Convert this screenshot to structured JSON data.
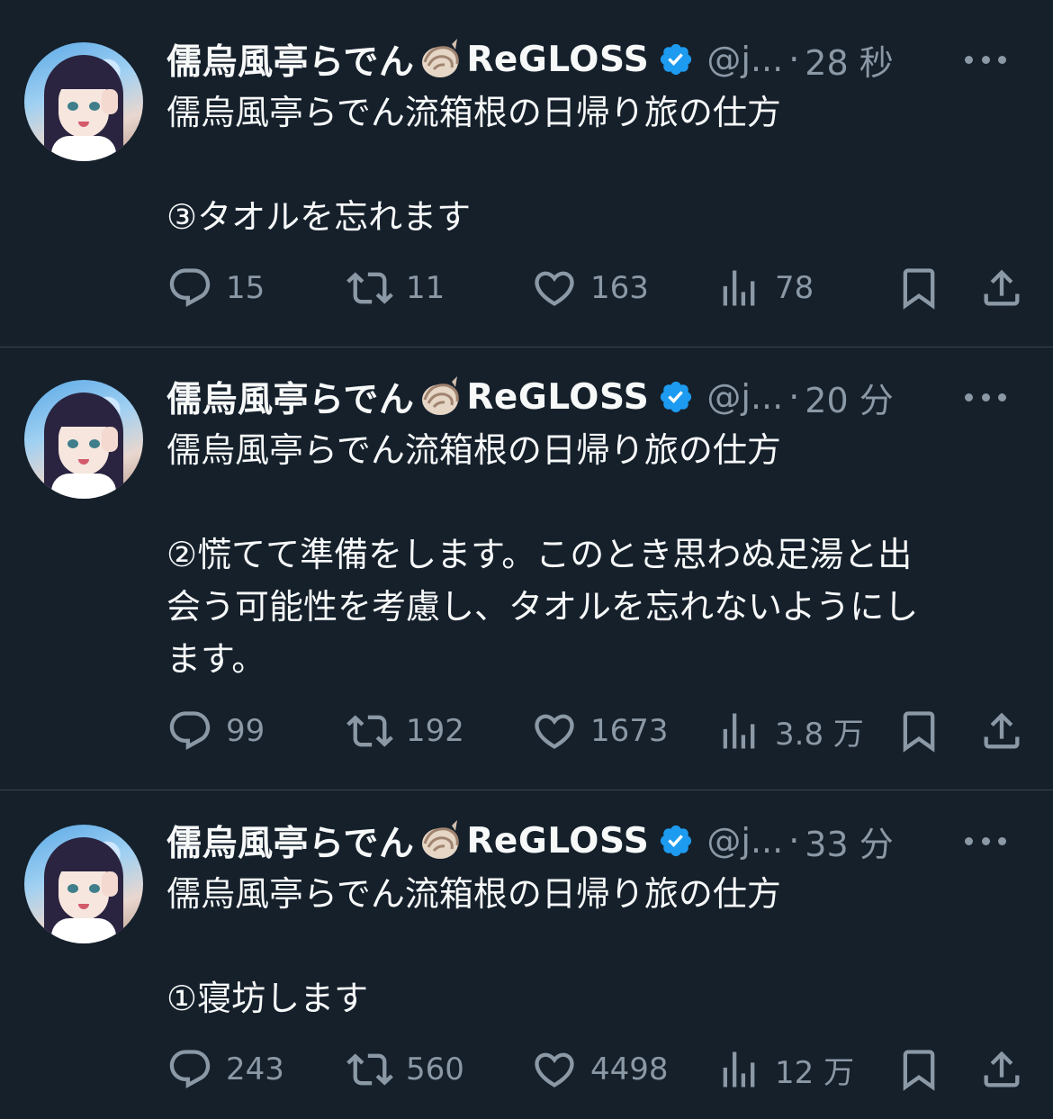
{
  "tweets": [
    {
      "author": {
        "name": "儒烏風亭らでん",
        "suffix": "ReGLOSS",
        "handle": "@j...",
        "shell_icon": "spiral-shell-emoji",
        "badge": "verified-badge"
      },
      "time": "28 秒",
      "separator": "·",
      "title": "儒烏風亭らでん流箱根の日帰り旅の仕方",
      "body": "③タオルを忘れます",
      "stats": {
        "replies": "15",
        "retweets": "11",
        "likes": "163",
        "views": "78"
      }
    },
    {
      "author": {
        "name": "儒烏風亭らでん",
        "suffix": "ReGLOSS",
        "handle": "@j...",
        "shell_icon": "spiral-shell-emoji",
        "badge": "verified-badge"
      },
      "time": "20 分",
      "separator": "·",
      "title": "儒烏風亭らでん流箱根の日帰り旅の仕方",
      "body": "②慌てて準備をします。このとき思わぬ足湯と出\n会う可能性を考慮し、タオルを忘れないようにし\nます。",
      "stats": {
        "replies": "99",
        "retweets": "192",
        "likes": "1673",
        "views": "3.8 万"
      }
    },
    {
      "author": {
        "name": "儒烏風亭らでん",
        "suffix": "ReGLOSS",
        "handle": "@j...",
        "shell_icon": "spiral-shell-emoji",
        "badge": "verified-badge"
      },
      "time": "33 分",
      "separator": "·",
      "title": "儒烏風亭らでん流箱根の日帰り旅の仕方",
      "body": "①寝坊します",
      "stats": {
        "replies": "243",
        "retweets": "560",
        "likes": "4498",
        "views": "12 万"
      }
    }
  ],
  "colors": {
    "background": "#15202b",
    "text": "#f7f9f9",
    "muted": "#8b98a5",
    "verified": "#1d9bf0",
    "divider": "#38444d"
  }
}
